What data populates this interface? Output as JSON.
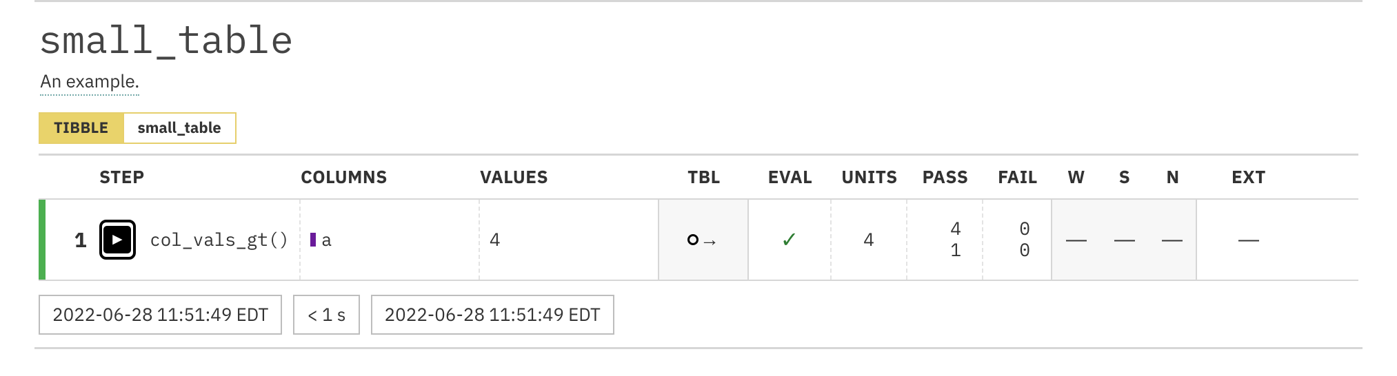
{
  "header": {
    "title": "small_table",
    "subtitle": "An example.",
    "badge_type": "TIBBLE",
    "badge_name": "small_table"
  },
  "columns": {
    "step": "STEP",
    "columns": "COLUMNS",
    "values": "VALUES",
    "tbl": "TBL",
    "eval": "EVAL",
    "units": "UNITS",
    "pass": "PASS",
    "fail": "FAIL",
    "w": "W",
    "s": "S",
    "n": "N",
    "ext": "EXT"
  },
  "row": {
    "index": "1",
    "assertion": "col_vals_gt()",
    "column": "a",
    "value": "4",
    "units": "4",
    "pass_n": "4",
    "pass_frac": "1",
    "fail_n": "0",
    "fail_frac": "0",
    "w": "—",
    "s": "—",
    "n": "—",
    "ext": "—"
  },
  "footer": {
    "start_time": "2022-06-28 11:51:49 EDT",
    "duration": "< 1 s",
    "end_time": "2022-06-28 11:51:49 EDT"
  }
}
